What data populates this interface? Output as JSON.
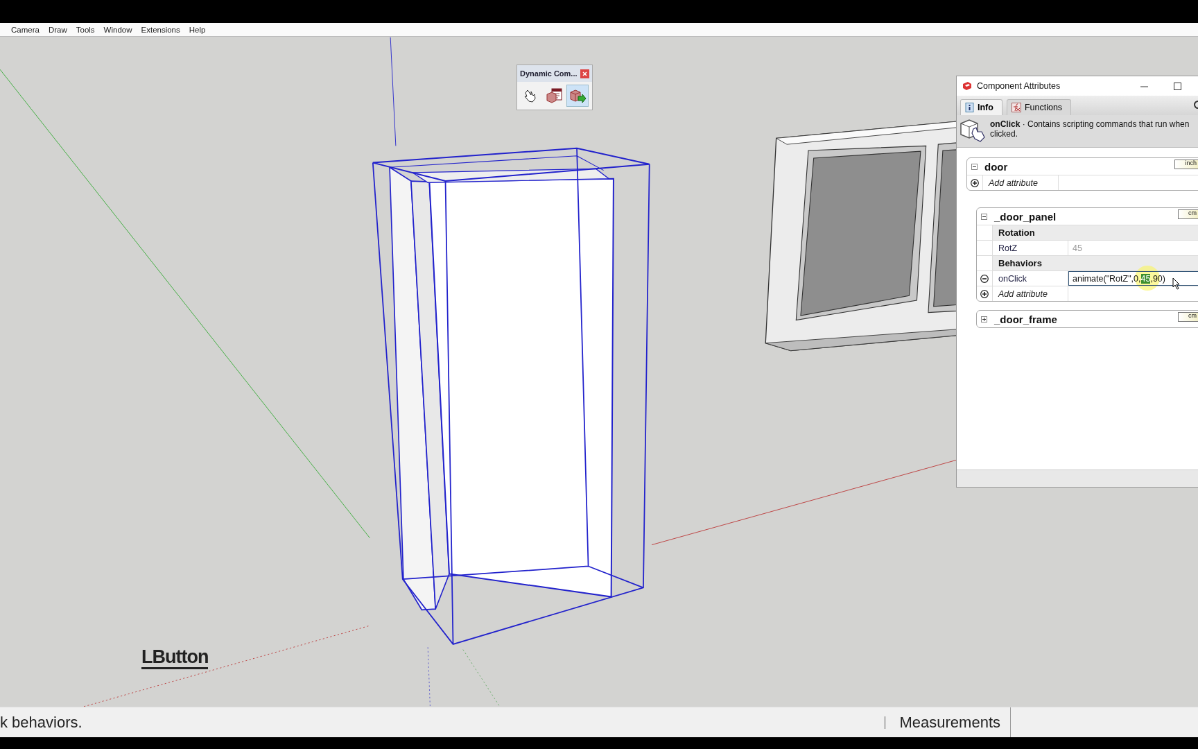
{
  "menu": [
    {
      "label": "Camera"
    },
    {
      "label": "Draw"
    },
    {
      "label": "Tools"
    },
    {
      "label": "Window"
    },
    {
      "label": "Extensions"
    },
    {
      "label": "Help"
    }
  ],
  "toolbar": {
    "title": "Dynamic Com...",
    "tools": [
      {
        "kind": "interact",
        "selected": false
      },
      {
        "kind": "options",
        "selected": false
      },
      {
        "kind": "attributes",
        "selected": true
      }
    ]
  },
  "viewport": {
    "label": "LButton"
  },
  "panel": {
    "title": "Component Attributes",
    "tabs": [
      {
        "label": "Info",
        "kind": "info",
        "selected": true
      },
      {
        "label": "Functions",
        "kind": "functions",
        "selected": false
      }
    ],
    "info": "**onClick** · Contains scripting commands that run when clicked.",
    "components": [
      {
        "name": "door",
        "unit": "inch",
        "expanded": true,
        "rows": [
          {
            "kind": "add",
            "label": "Add attribute"
          }
        ],
        "children": [
          {
            "name": "_door_panel",
            "unit": "cm",
            "expanded": true,
            "rows": [
              {
                "kind": "section",
                "label": "Rotation"
              },
              {
                "kind": "attribute",
                "label": "RotZ",
                "value": "45"
              },
              {
                "kind": "section",
                "label": "Behaviors"
              },
              {
                "kind": "edit",
                "label": "onClick",
                "parts": [
                  {
                    "text": "animate(\"RotZ\",0,",
                    "selected": false
                  },
                  {
                    "text": "45",
                    "selected": true
                  },
                  {
                    "text": ",90)",
                    "selected": false
                  }
                ]
              },
              {
                "kind": "add",
                "label": "Add attribute"
              }
            ]
          },
          {
            "name": "_door_frame",
            "unit": "cm",
            "expanded": false
          }
        ]
      }
    ]
  },
  "status_bar": {
    "hint": "k behaviors.",
    "measurements": "Measurements"
  }
}
